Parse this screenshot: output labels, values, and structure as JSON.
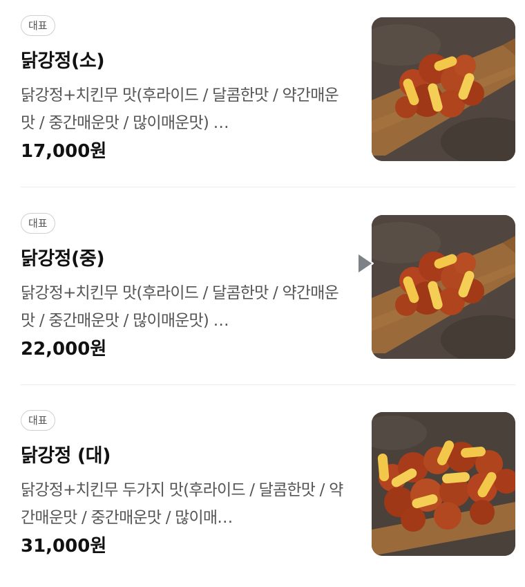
{
  "menu": {
    "items": [
      {
        "badge": "대표",
        "name": "닭강정(소)",
        "description": "닭강정+치킨무 맛(후라이드 / 달콤한맛 / 약간매운맛 / 중간매운맛 / 많이매운맛) …",
        "price": "17,000원",
        "image_icon": "fried-chicken-board-photo"
      },
      {
        "badge": "대표",
        "name": "닭강정(중)",
        "description": "닭강정+치킨무 맛(후라이드 / 달콤한맛 / 약간매운맛 / 중간매운맛 / 많이매운맛) …",
        "price": "22,000원",
        "image_icon": "fried-chicken-board-photo"
      },
      {
        "badge": "대표",
        "name": "닭강정 (대)",
        "description": "닭강정+치킨무 두가지 맛(후라이드 / 달콤한맛 / 약간매운맛 / 중간매운맛 / 많이매…",
        "price": "31,000원",
        "image_icon": "fried-chicken-board-photo"
      }
    ]
  },
  "colors": {
    "badge_border": "#cfcfcf",
    "text_primary": "#111111",
    "text_secondary": "#555555",
    "divider": "#ececec"
  }
}
